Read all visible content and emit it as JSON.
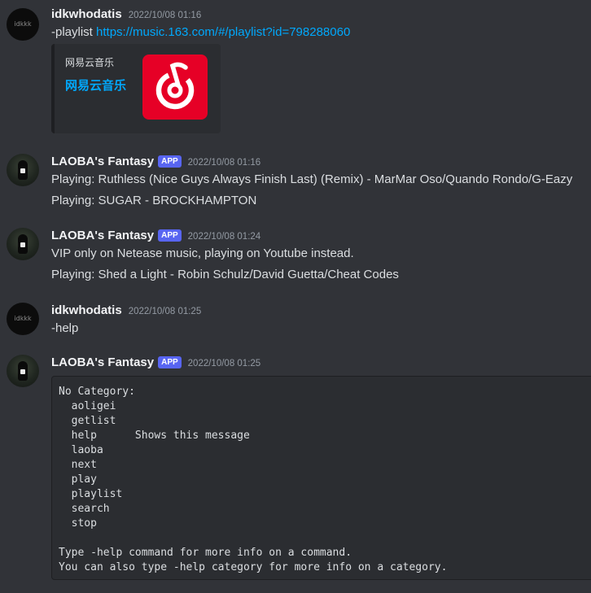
{
  "messages": {
    "m1": {
      "avatar_text": "idkkk",
      "username": "idkwhodatis",
      "timestamp": "2022/10/08 01:16",
      "command": "-playlist ",
      "link": "https://music.163.com/#/playlist?id=798288060",
      "embed": {
        "provider": "网易云音乐",
        "title": "网易云音乐"
      }
    },
    "m2": {
      "username": "LAOBA's Fantasy",
      "tag": "APP",
      "timestamp": "2022/10/08 01:16",
      "lines": [
        "Playing: Ruthless (Nice Guys Always Finish Last) (Remix) - MarMar Oso/Quando Rondo/G-Eazy",
        "Playing: SUGAR - BROCKHAMPTON"
      ]
    },
    "m3": {
      "username": "LAOBA's Fantasy",
      "tag": "APP",
      "timestamp": "2022/10/08 01:24",
      "lines": [
        "VIP only on Netease music, playing on Youtube instead.",
        "Playing: Shed a Light - Robin Schulz/David Guetta/Cheat Codes"
      ]
    },
    "m4": {
      "avatar_text": "idkkk",
      "username": "idkwhodatis",
      "timestamp": "2022/10/08 01:25",
      "lines": [
        "-help"
      ]
    },
    "m5": {
      "username": "LAOBA's Fantasy",
      "tag": "APP",
      "timestamp": "2022/10/08 01:25",
      "code_lines": [
        "No Category:",
        "  aoligei",
        "  getlist",
        "  help      Shows this message",
        "  laoba",
        "  next",
        "  play",
        "  playlist",
        "  search",
        "  stop",
        "",
        "Type -help command for more info on a command.",
        "You can also type -help category for more info on a category."
      ]
    }
  },
  "colors": {
    "background": "#313338",
    "link": "#00a8fc",
    "app_tag": "#5865f2",
    "netease_red": "#e60026"
  },
  "icons": [
    "netease-music-logo-icon"
  ]
}
